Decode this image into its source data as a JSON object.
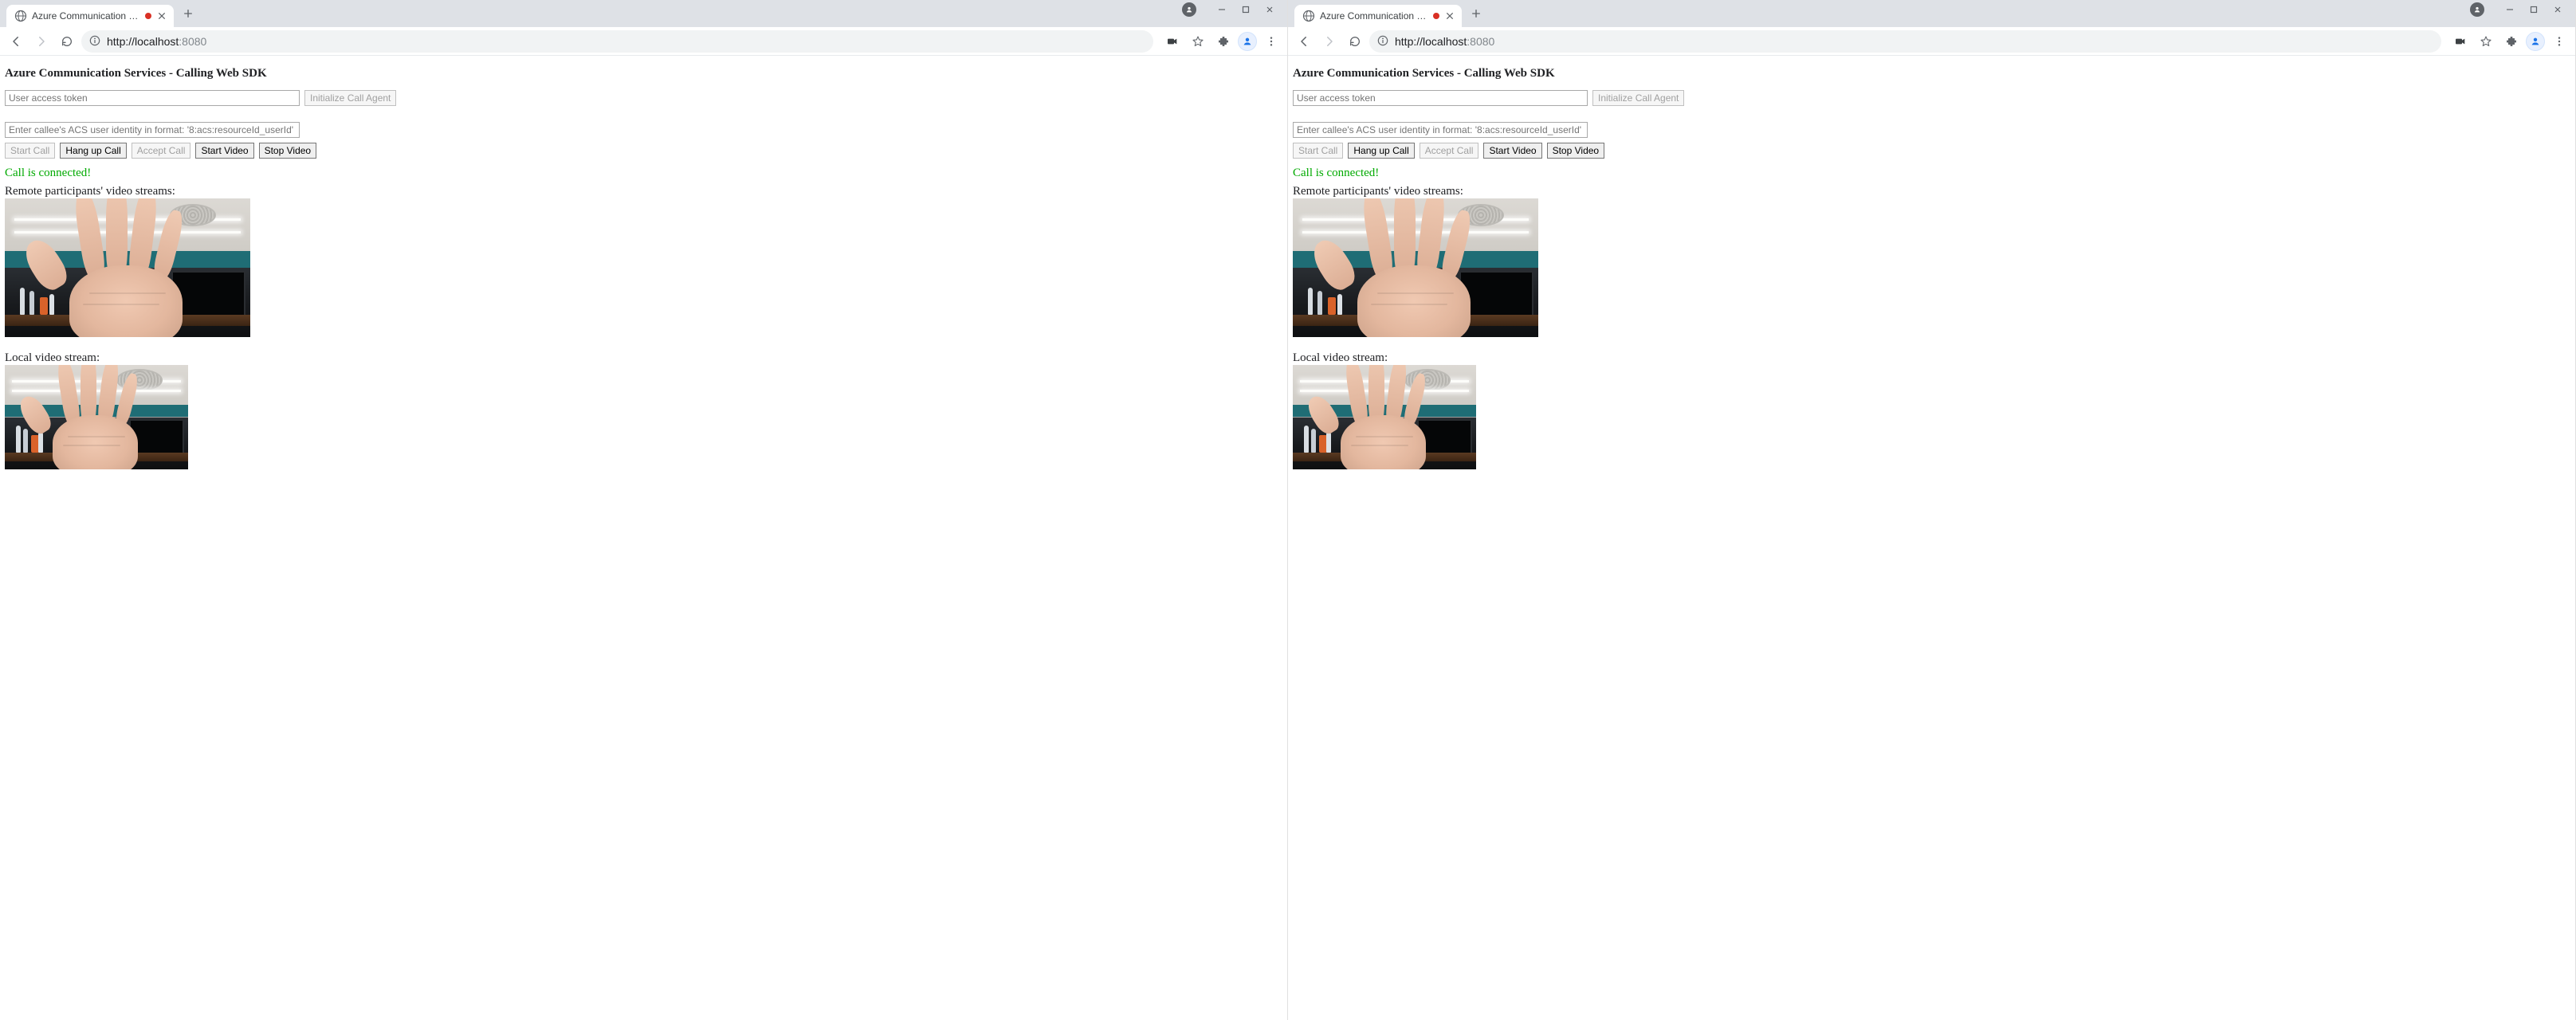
{
  "windows": [
    {
      "tab": {
        "title": "Azure Communication Servic",
        "recording": true
      },
      "url": {
        "scheme": "http://",
        "host": "localhost",
        "port": ":8080"
      },
      "page": {
        "heading": "Azure Communication Services - Calling Web SDK",
        "token_placeholder": "User access token",
        "init_button": "Initialize Call Agent",
        "callee_placeholder": "Enter callee's ACS user identity in format: '8:acs:resourceId_userId'",
        "buttons": {
          "start_call": "Start Call",
          "hang_up": "Hang up Call",
          "accept_call": "Accept Call",
          "start_video": "Start Video",
          "stop_video": "Stop Video"
        },
        "status": "Call is connected!",
        "remote_label": "Remote participants' video streams:",
        "local_label": "Local video stream:"
      }
    },
    {
      "tab": {
        "title": "Azure Communication Servic",
        "recording": true
      },
      "url": {
        "scheme": "http://",
        "host": "localhost",
        "port": ":8080"
      },
      "page": {
        "heading": "Azure Communication Services - Calling Web SDK",
        "token_placeholder": "User access token",
        "init_button": "Initialize Call Agent",
        "callee_placeholder": "Enter callee's ACS user identity in format: '8:acs:resourceId_userId'",
        "buttons": {
          "start_call": "Start Call",
          "hang_up": "Hang up Call",
          "accept_call": "Accept Call",
          "start_video": "Start Video",
          "stop_video": "Stop Video"
        },
        "status": "Call is connected!",
        "remote_label": "Remote participants' video streams:",
        "local_label": "Local video stream:"
      }
    }
  ]
}
